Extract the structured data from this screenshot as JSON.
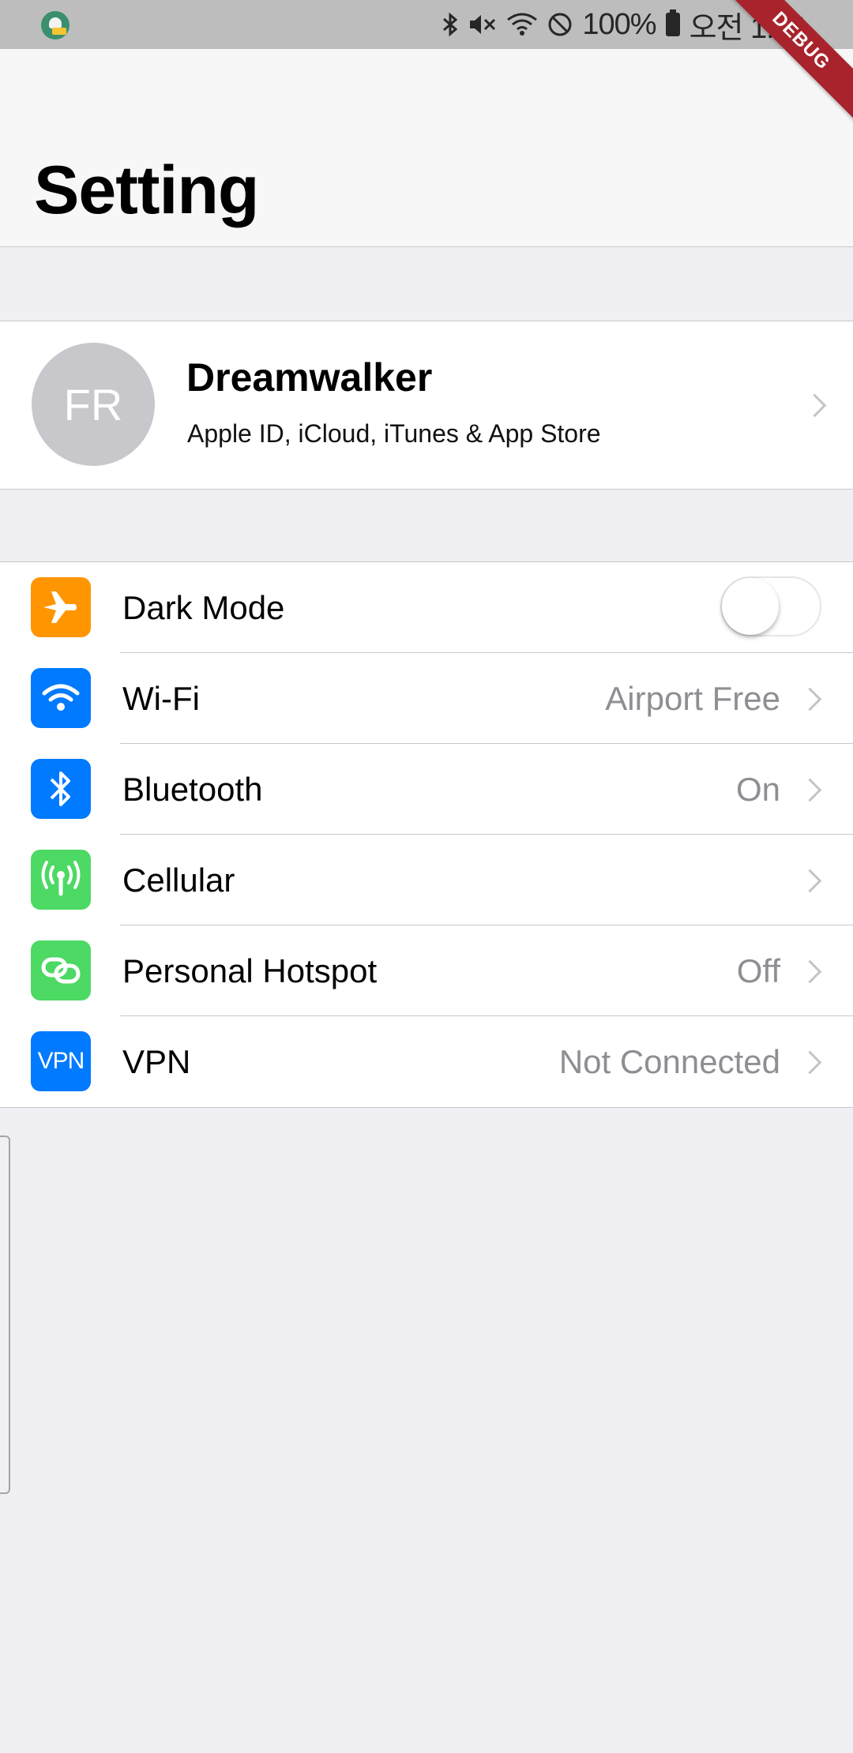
{
  "status_bar": {
    "battery": "100%",
    "time": "오전 1:24",
    "icons": [
      "app-notification-icon",
      "bluetooth-icon",
      "mute-icon",
      "wifi-icon",
      "do-not-disturb-icon",
      "battery-icon"
    ]
  },
  "debug_banner": "DEBUG",
  "header": {
    "title": "Setting"
  },
  "profile": {
    "initials": "FR",
    "name": "Dreamwalker",
    "subtitle": "Apple ID, iCloud, iTunes & App Store"
  },
  "settings": [
    {
      "label": "Dark Mode",
      "icon": "airplane-icon",
      "color": "#ff9500",
      "type": "toggle",
      "on": false
    },
    {
      "label": "Wi-Fi",
      "value": "Airport Free",
      "icon": "wifi-icon",
      "color": "#007aff",
      "type": "link"
    },
    {
      "label": "Bluetooth",
      "value": "On",
      "icon": "bluetooth-icon",
      "color": "#007aff",
      "type": "link"
    },
    {
      "label": "Cellular",
      "value": "",
      "icon": "cellular-antenna-icon",
      "color": "#4cd964",
      "type": "link"
    },
    {
      "label": "Personal Hotspot",
      "value": "Off",
      "icon": "hotspot-chain-icon",
      "color": "#4cd964",
      "type": "link"
    },
    {
      "label": "VPN",
      "value": "Not Connected",
      "icon": "vpn-icon",
      "icon_text": "VPN",
      "color": "#007aff",
      "type": "link"
    }
  ]
}
